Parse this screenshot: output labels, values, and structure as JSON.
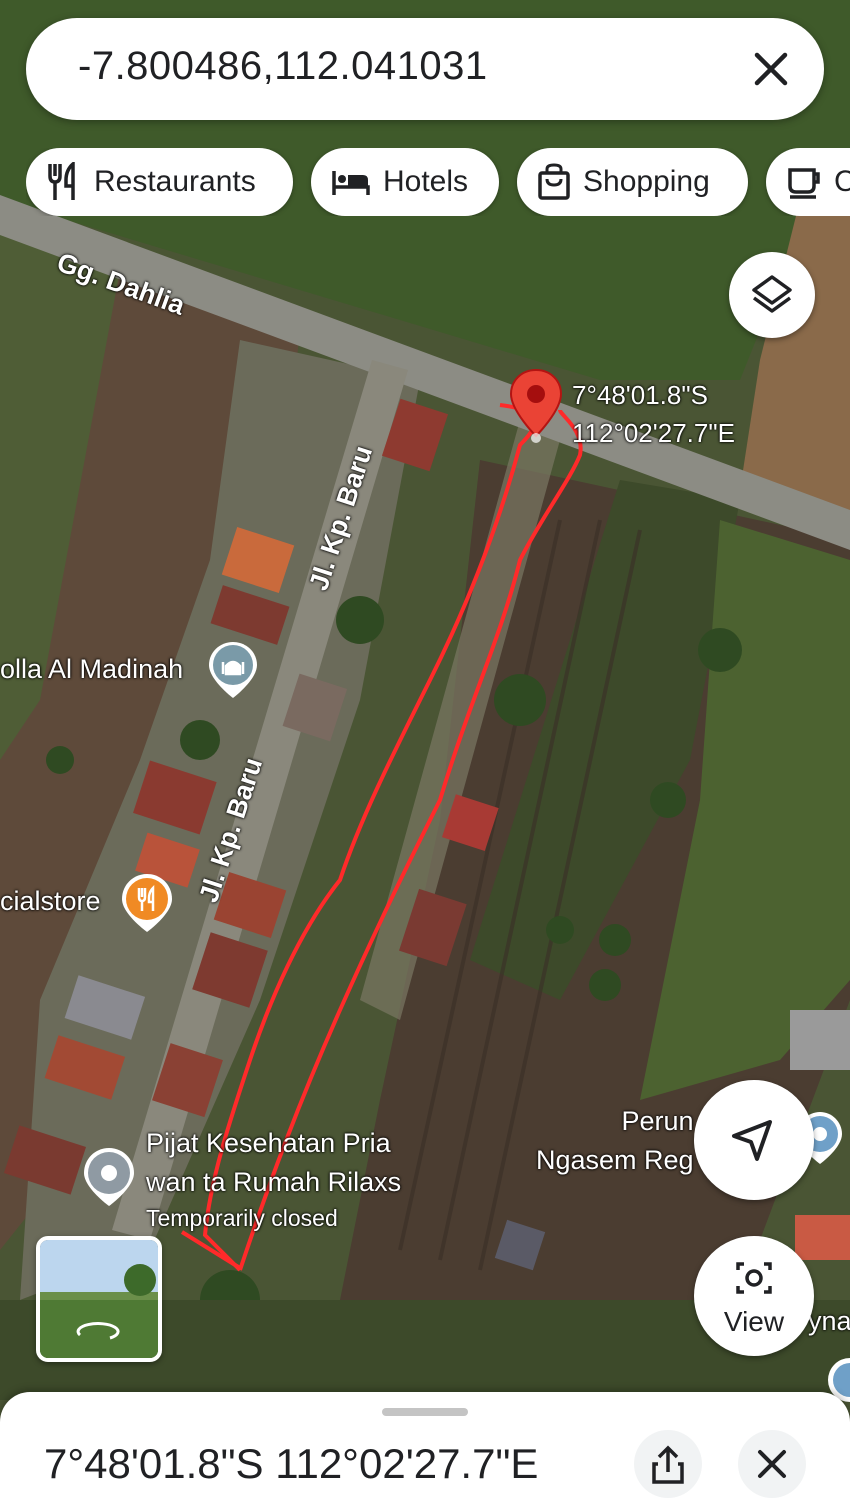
{
  "search": {
    "query": "-7.800486,112.041031"
  },
  "chips": [
    {
      "label": "Restaurants",
      "icon": "fork-knife-icon"
    },
    {
      "label": "Hotels",
      "icon": "bed-icon"
    },
    {
      "label": "Shopping",
      "icon": "shopping-bag-icon"
    },
    {
      "label": "C",
      "icon": "coffee-icon"
    }
  ],
  "map": {
    "roads": {
      "road1": "Gg. Dahlia",
      "road2": "Jl. Kp. Baru",
      "road3": "Jl. Kp. Baru"
    },
    "pin": {
      "lat": "7°48'01.8\"S",
      "lng": "112°02'27.7\"E",
      "color": "#ea4335"
    },
    "places": {
      "mosque": "olla Al Madinah",
      "store": "cialstore",
      "massage_line1": "Pijat Kesehatan Pria",
      "massage_line2": "wan ta Rumah Rilaxs",
      "massage_status": "Temporarily closed",
      "perum_line1": "Perun",
      "perum_line2": "Ngasem Reg",
      "edge_label": "yna"
    },
    "view_button": "View",
    "annotation_color": "#ff2a2a"
  },
  "sheet": {
    "title": "7°48'01.8\"S 112°02'27.7\"E"
  }
}
